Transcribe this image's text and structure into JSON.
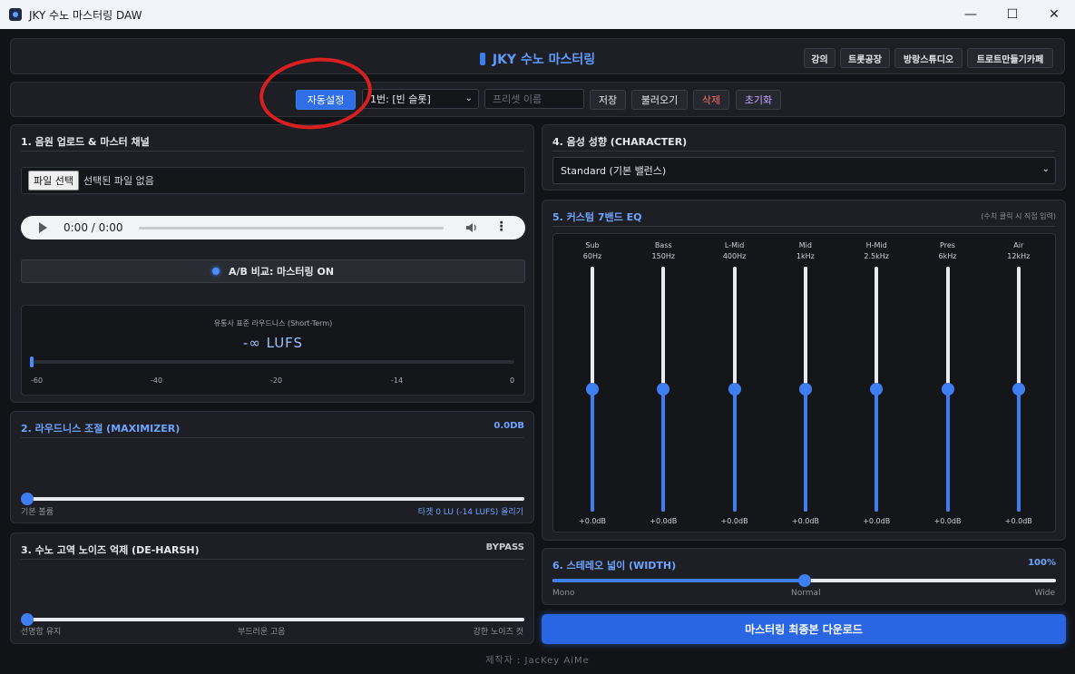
{
  "window": {
    "title": "JKY 수노 마스터링 DAW",
    "controls": [
      "—",
      "☐",
      "✕"
    ]
  },
  "header": {
    "title": "JKY 수노 마스터링",
    "links": [
      "강의",
      "트롯공장",
      "방랑스튜디오",
      "트로트만들기카페"
    ]
  },
  "toolbar": {
    "auto": "자동설정",
    "slot": "1번: [빈 슬롯]",
    "preset_placeholder": "프리셋 이름",
    "save": "저장",
    "load": "불러오기",
    "delete": "삭제",
    "reset": "초기화"
  },
  "upload": {
    "title": "1. 음원 업로드 & 마스터 채널",
    "file_button": "파일 선택",
    "file_status": "선택된 파일 없음",
    "audio_time": "0:00 / 0:00",
    "ab": "A/B 비교: 마스터링 ON",
    "meter_label": "유통사 표준 라우드니스 (Short-Term)",
    "meter_value": "-∞ LUFS",
    "ticks": [
      "-60",
      "-40",
      "-20",
      "-14",
      "0"
    ]
  },
  "maximizer": {
    "title": "2. 라우드니스 조절 (MAXIMIZER)",
    "value": "0.0DB",
    "level": 0,
    "left": "기본 볼륨",
    "right": "타겟 0 LU (-14 LUFS) 올리기"
  },
  "deharsh": {
    "title": "3. 수노 고역 노이즈 억제 (DE-HARSH)",
    "value": "BYPASS",
    "level": 0,
    "labels": [
      "선명함 유지",
      "부드러운 고음",
      "강한 노이즈 컷"
    ]
  },
  "character": {
    "title": "4. 음성 성향 (CHARACTER)",
    "selected": "Standard (기본 밸런스)"
  },
  "eq": {
    "title": "5. 커스텀 7밴드 EQ",
    "hint": "(수치 클릭 시 직접 입력)",
    "bands": [
      {
        "name": "Sub",
        "freq": "60Hz",
        "value": "+0.0dB",
        "gain": 0
      },
      {
        "name": "Bass",
        "freq": "150Hz",
        "value": "+0.0dB",
        "gain": 0
      },
      {
        "name": "L-Mid",
        "freq": "400Hz",
        "value": "+0.0dB",
        "gain": 0
      },
      {
        "name": "Mid",
        "freq": "1kHz",
        "value": "+0.0dB",
        "gain": 0
      },
      {
        "name": "H-Mid",
        "freq": "2.5kHz",
        "value": "+0.0dB",
        "gain": 0
      },
      {
        "name": "Pres",
        "freq": "6kHz",
        "value": "+0.0dB",
        "gain": 0
      },
      {
        "name": "Air",
        "freq": "12kHz",
        "value": "+0.0dB",
        "gain": 0
      }
    ]
  },
  "width": {
    "title": "6. 스테레오 넓이 (WIDTH)",
    "value": "100%",
    "level": 0.5,
    "labels": [
      "Mono",
      "Normal",
      "Wide"
    ]
  },
  "download": "마스터링 최종본 다운로드",
  "credit": "제작자 : JacKey AiMe",
  "colors": {
    "accent": "#3f7ef0",
    "bg": "#121316",
    "panel": "#1e1f24",
    "delete": "#ff6b6b",
    "reset": "#c7a6ff",
    "annotation": "#d82020"
  }
}
